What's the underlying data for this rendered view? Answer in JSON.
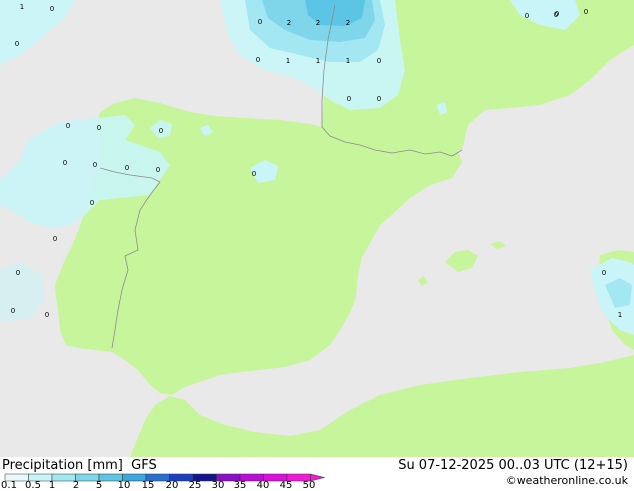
{
  "map": {
    "colors": {
      "sea": "#e9e9e9",
      "land": "#c7f59b",
      "precip_0_1": "#c9f5f8",
      "precip_0_5": "#a2e7f1",
      "precip_1": "#7fd6ea",
      "precip_2": "#5cc4e4",
      "border": "#7f7f7f"
    },
    "point_values": [
      {
        "id": "p1",
        "text": "1"
      },
      {
        "id": "p2",
        "text": "0"
      },
      {
        "id": "p3",
        "text": "0"
      },
      {
        "id": "p4",
        "text": "0"
      },
      {
        "id": "p5",
        "text": "2"
      },
      {
        "id": "p6",
        "text": "2"
      },
      {
        "id": "p7",
        "text": "2"
      },
      {
        "id": "p8",
        "text": "0"
      },
      {
        "id": "p9",
        "text": "1"
      },
      {
        "id": "p10",
        "text": "1"
      },
      {
        "id": "p11",
        "text": "1"
      },
      {
        "id": "p12",
        "text": "0"
      },
      {
        "id": "p13",
        "text": "0"
      },
      {
        "id": "p14",
        "text": "0"
      },
      {
        "id": "p15",
        "text": "0"
      },
      {
        "id": "p16",
        "text": "0"
      },
      {
        "id": "p17",
        "text": "0"
      },
      {
        "id": "p18",
        "text": "0"
      },
      {
        "id": "p19",
        "text": "0"
      },
      {
        "id": "p20",
        "text": "0"
      },
      {
        "id": "p21",
        "text": "0"
      },
      {
        "id": "p22",
        "text": "0"
      },
      {
        "id": "p23",
        "text": "0"
      },
      {
        "id": "p24",
        "text": "0"
      },
      {
        "id": "p25",
        "text": "0"
      },
      {
        "id": "p26",
        "text": "0"
      },
      {
        "id": "p27",
        "text": "0"
      },
      {
        "id": "p28",
        "text": "0"
      },
      {
        "id": "p29",
        "text": "0"
      },
      {
        "id": "p30",
        "text": "0"
      },
      {
        "id": "p31",
        "text": "0"
      },
      {
        "id": "p32",
        "text": "0"
      },
      {
        "id": "p33",
        "text": "1"
      }
    ]
  },
  "footer": {
    "title": "Precipitation [mm]",
    "model": "GFS",
    "valid_time": "Su 07-12-2025 00..03 UTC (12+15)",
    "credit": "©weatheronline.co.uk",
    "scale_labels": [
      "0.1",
      "0.5",
      "1",
      "2",
      "5",
      "10",
      "15",
      "20",
      "25",
      "30",
      "35",
      "40",
      "45",
      "50"
    ],
    "scale_colors": [
      "#e8f9fb",
      "#c9f5f8",
      "#a2e7f1",
      "#7fd6ea",
      "#5cc4e4",
      "#3aa8dc",
      "#2a6fd0",
      "#1d3fbf",
      "#15168f",
      "#8a10c8",
      "#b90fd6",
      "#db10dc",
      "#f21ad9"
    ]
  }
}
